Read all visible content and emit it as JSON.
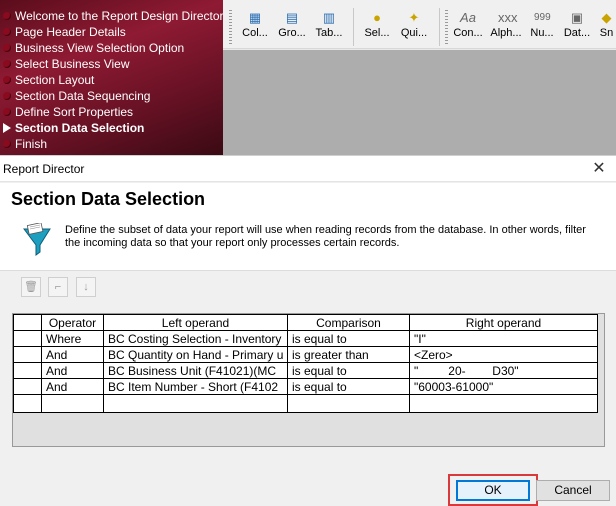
{
  "nav": {
    "items": [
      {
        "label": "Welcome to the Report Design Director",
        "current": false
      },
      {
        "label": "Page Header Details",
        "current": false
      },
      {
        "label": "Business View Selection Option",
        "current": false
      },
      {
        "label": "Select Business View",
        "current": false
      },
      {
        "label": "Section Layout",
        "current": false
      },
      {
        "label": "Section Data Sequencing",
        "current": false
      },
      {
        "label": "Define Sort Properties",
        "current": false
      },
      {
        "label": "Section Data Selection",
        "current": true
      },
      {
        "label": "Finish",
        "current": false
      }
    ]
  },
  "toolbar": {
    "buttons": [
      {
        "label": "Col...",
        "icon": "column-icon"
      },
      {
        "label": "Gro...",
        "icon": "group-icon"
      },
      {
        "label": "Tab...",
        "icon": "tabular-icon"
      },
      {
        "label": "Sel...",
        "icon": "selection-icon"
      },
      {
        "label": "Qui...",
        "icon": "quick-icon"
      },
      {
        "label": "Con...",
        "icon": "constant-icon"
      },
      {
        "label": "Alph...",
        "icon": "alpha-icon"
      },
      {
        "label": "Nu...",
        "icon": "numeric-icon"
      },
      {
        "label": "Dat...",
        "icon": "date-icon"
      },
      {
        "label": "Sn",
        "icon": "snap-icon"
      }
    ]
  },
  "dialog": {
    "window_title": "Report Director",
    "close_glyph": "✕",
    "title": "Section Data Selection",
    "description": "Define the subset of data your report will use when reading records from the database.  In other words, filter the incoming data so that your report only processes certain records.",
    "grid": {
      "columns": [
        "Operator",
        "Left operand",
        "Comparison",
        "Right operand"
      ],
      "rows": [
        {
          "operator": "Where",
          "left": "BC Costing Selection - Inventory",
          "comparison": "is equal to",
          "right": "\"I\""
        },
        {
          "operator": "And",
          "left": "BC Quantity on Hand - Primary u",
          "comparison": "is greater than",
          "right": "<Zero>"
        },
        {
          "operator": "And",
          "left": "BC Business Unit (F41021)(MC",
          "comparison": "is equal to",
          "right": "\"         20-        D30\""
        },
        {
          "operator": "And",
          "left": "BC Item Number - Short (F4102",
          "comparison": "is equal to",
          "right": "\"60003-61000\""
        }
      ]
    },
    "ok_label": "OK",
    "cancel_label": "Cancel"
  }
}
